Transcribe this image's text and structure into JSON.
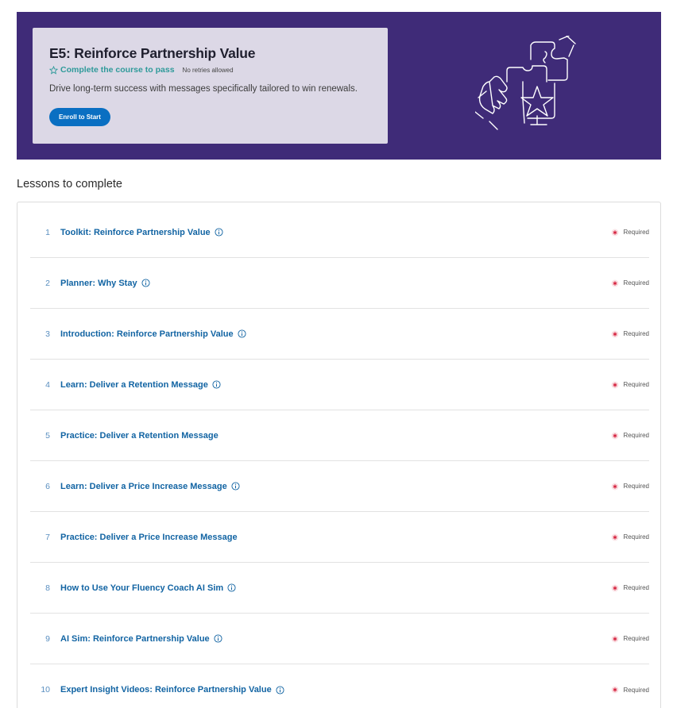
{
  "course": {
    "title": "E5: Reinforce Partnership Value",
    "pass_requirement": "Complete the course to pass",
    "retries": "No retries allowed",
    "description": "Drive long-term success with messages specifically tailored to win renewals.",
    "enroll_label": "Enroll to Start",
    "colors": {
      "hero_bg": "#3f2b78",
      "card_bg": "#dcd8e6",
      "accent": "#0a6fc2",
      "pass": "#2f9a9a"
    }
  },
  "lessons_section": {
    "title": "Lessons to complete",
    "required_label": "Required",
    "items": [
      {
        "num": "1",
        "title": "Toolkit: Reinforce Partnership Value",
        "info": true
      },
      {
        "num": "2",
        "title": "Planner: Why Stay",
        "info": true
      },
      {
        "num": "3",
        "title": "Introduction: Reinforce Partnership Value",
        "info": true
      },
      {
        "num": "4",
        "title": "Learn: Deliver a Retention Message",
        "info": true
      },
      {
        "num": "5",
        "title": "Practice: Deliver a Retention Message",
        "info": false
      },
      {
        "num": "6",
        "title": "Learn: Deliver a Price Increase Message",
        "info": true
      },
      {
        "num": "7",
        "title": "Practice: Deliver a Price Increase Message",
        "info": false
      },
      {
        "num": "8",
        "title": "How to Use Your Fluency Coach AI Sim",
        "info": true
      },
      {
        "num": "9",
        "title": "AI Sim: Reinforce Partnership Value",
        "info": true
      },
      {
        "num": "10",
        "title": "Expert Insight Videos: Reinforce Partnership Value",
        "info": true
      }
    ]
  },
  "icons": {
    "pass": "star-outline-icon",
    "info": "info-circle-icon",
    "required": "required-asterisk-icon",
    "hero": "handshake-puzzle-star-icon"
  }
}
